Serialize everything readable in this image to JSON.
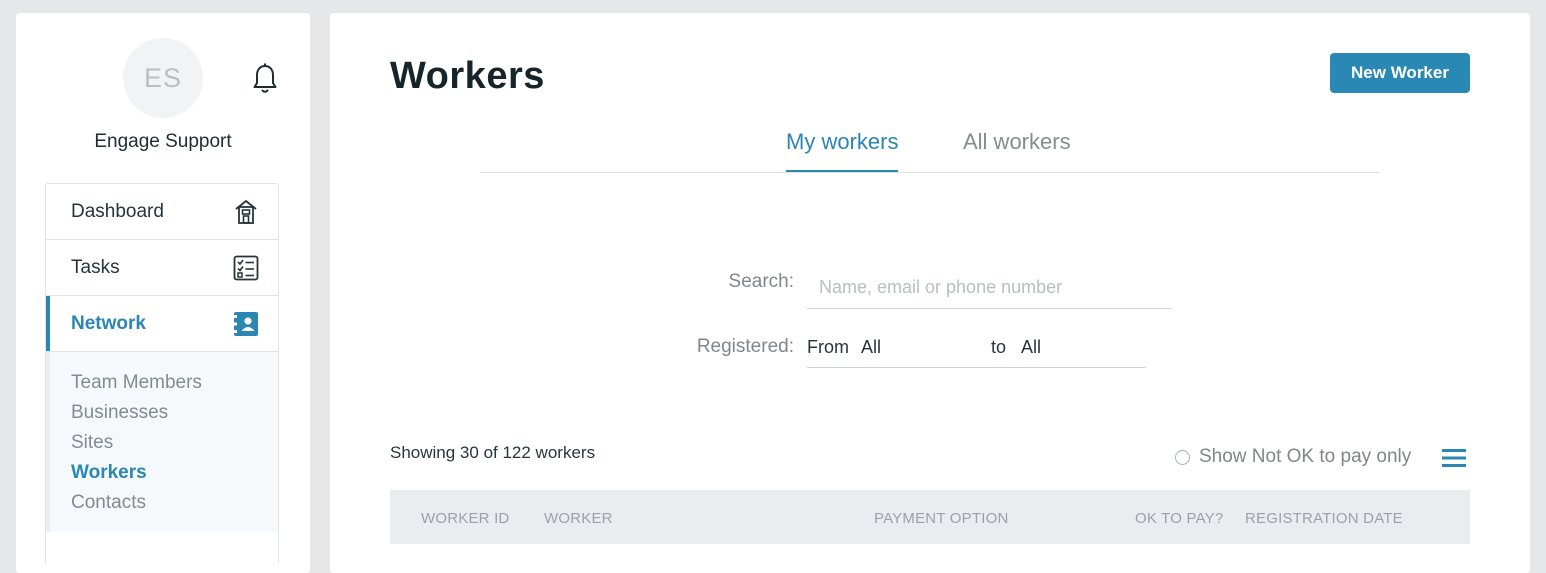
{
  "sidebar": {
    "avatar_initials": "ES",
    "user_name": "Engage Support",
    "nav": [
      {
        "label": "Dashboard",
        "icon": "building-icon"
      },
      {
        "label": "Tasks",
        "icon": "checklist-icon"
      },
      {
        "label": "Network",
        "icon": "contact-card-icon",
        "active": true
      }
    ],
    "subnav": [
      {
        "label": "Team Members"
      },
      {
        "label": "Businesses"
      },
      {
        "label": "Sites"
      },
      {
        "label": "Workers",
        "active": true
      },
      {
        "label": "Contacts"
      }
    ]
  },
  "header": {
    "title": "Workers",
    "new_button": "New Worker"
  },
  "tabs": [
    {
      "label": "My workers",
      "active": true
    },
    {
      "label": "All workers"
    }
  ],
  "filters": {
    "search_label": "Search:",
    "search_placeholder": "Name, email or phone number",
    "registered_label": "Registered:",
    "from_label": "From",
    "from_value": "All",
    "to_label": "to",
    "to_value": "All"
  },
  "results": {
    "showing_text": "Showing 30 of 122 workers",
    "not_ok_label": "Show Not OK to pay only"
  },
  "table": {
    "columns": [
      "WORKER ID",
      "WORKER",
      "PAYMENT OPTION",
      "OK TO PAY?",
      "REGISTRATION DATE"
    ]
  },
  "colors": {
    "accent": "#2a86b3",
    "button": "#2a88b5",
    "background": "#e6e7e9",
    "table_header": "#e9edf0"
  }
}
